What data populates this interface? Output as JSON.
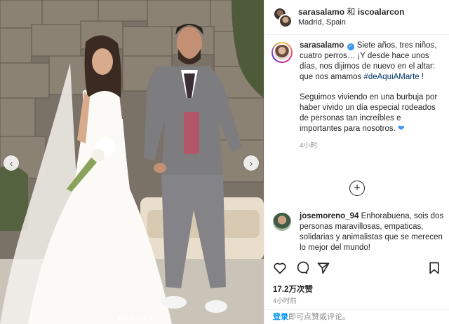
{
  "header": {
    "user1": "sarasalamo",
    "conjunction": "和",
    "user2": "iscoalarcon",
    "location": "Madrid, Spain"
  },
  "caption": {
    "username": "sarasalamo",
    "text1": "Siete años, tres niños, cuatro perros… ¡Y desde hace unos días, nos dijimos de nuevo en el altar: que nos amamos",
    "hashtag": "#deAquiAMarte",
    "text1_end": " !",
    "text2": "Seguimos viviendo en una burbuja por haber vivido un día especial rodeados de personas tan increíbles e importantes para nosotros.",
    "time": "4小时"
  },
  "comment": {
    "username": "josemoreno_94",
    "text": "Enhorabuena, sois dos personas maravillosas, empaticas, solidarias y animalistas que se merecen lo mejor del mundo!"
  },
  "post": {
    "likes": "17.2万次赞",
    "time": "4小时前"
  },
  "login": {
    "link": "登录",
    "rest": "即可点赞或评论。"
  },
  "icons": {
    "like": "heart-outline-icon",
    "comment": "speech-bubble-icon",
    "share": "paper-plane-icon",
    "save": "bookmark-icon",
    "load_more": "plus-circle-icon",
    "carousel_prev": "chevron-left-icon",
    "carousel_next": "chevron-right-icon"
  },
  "carousel": {
    "slide_count": 6,
    "active_index": 0
  },
  "colors": {
    "verified": "#3897f0",
    "hashtag": "#00376b",
    "login_link": "#0095f6",
    "muted": "#8e8e8e"
  }
}
